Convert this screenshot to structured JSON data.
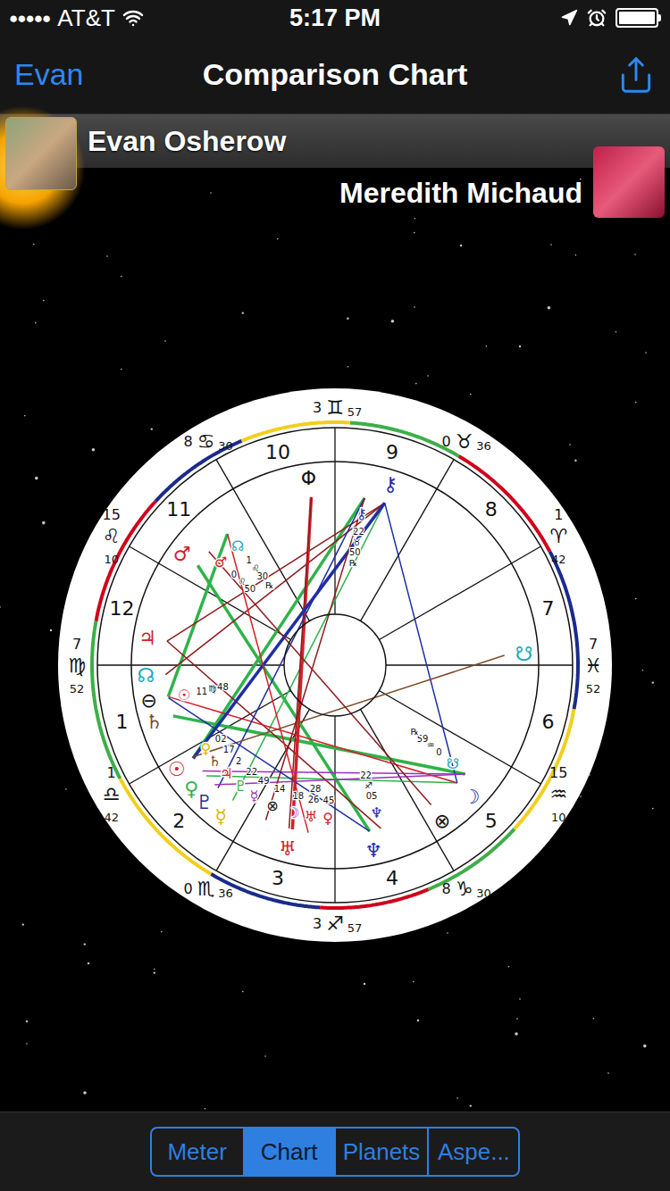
{
  "status_bar": {
    "signal": "●●●●●",
    "carrier": "AT&T",
    "time": "5:17 PM",
    "battery": {
      "level": 1
    }
  },
  "nav_bar": {
    "back": "Evan",
    "title": "Comparison Chart"
  },
  "people": [
    {
      "name": "Evan Osherow",
      "highlighted": true
    },
    {
      "name": "Meredith Michaud",
      "highlighted": false
    }
  ],
  "chart": {
    "cusps": [
      {
        "house": "1",
        "degree": "7",
        "sign": "♍",
        "minutes": "52",
        "longitude": 157.87
      },
      {
        "house": "2",
        "degree": "1",
        "sign": "♎",
        "minutes": "42",
        "longitude": 181.7
      },
      {
        "house": "3",
        "degree": "0",
        "sign": "♏",
        "minutes": "36",
        "longitude": 210.6
      },
      {
        "house": "4",
        "degree": "3",
        "sign": "♐",
        "minutes": "57",
        "longitude": 243.95
      },
      {
        "house": "5",
        "degree": "8",
        "sign": "♑",
        "minutes": "30",
        "longitude": 278.5
      },
      {
        "house": "6",
        "degree": "15",
        "sign": "♒",
        "minutes": "10",
        "longitude": 315.17
      },
      {
        "house": "7",
        "degree": "7",
        "sign": "♓",
        "minutes": "52",
        "longitude": 337.87
      },
      {
        "house": "8",
        "degree": "1",
        "sign": "♈",
        "minutes": "42",
        "longitude": 1.7
      },
      {
        "house": "9",
        "degree": "0",
        "sign": "♉",
        "minutes": "36",
        "longitude": 30.6
      },
      {
        "house": "10",
        "degree": "3",
        "sign": "♊",
        "minutes": "57",
        "longitude": 63.95
      },
      {
        "house": "11",
        "degree": "8",
        "sign": "♋",
        "minutes": "30",
        "longitude": 98.5
      },
      {
        "house": "12",
        "degree": "15",
        "sign": "♌",
        "minutes": "10",
        "longitude": 135.17
      }
    ],
    "signs": [
      {
        "color": "#d0021b"
      },
      {
        "color": "#3fae49"
      },
      {
        "color": "#f2cf1d"
      },
      {
        "color": "#1a2b8c"
      },
      {
        "color": "#d0021b"
      },
      {
        "color": "#3fae49"
      },
      {
        "color": "#f2cf1d"
      },
      {
        "color": "#1a2b8c"
      },
      {
        "color": "#d0021b"
      },
      {
        "color": "#3fae49"
      },
      {
        "color": "#f2cf1d"
      },
      {
        "color": "#1a2b8c"
      }
    ],
    "planets": [
      {
        "glyph": "♂",
        "ring": "outer",
        "longitude": 127.8,
        "color": "#d3202a",
        "labels": []
      },
      {
        "glyph": "♃",
        "ring": "outer",
        "longitude": 151.7,
        "color": "#d3202a",
        "labels": []
      },
      {
        "glyph": "☊",
        "ring": "outer",
        "longitude": 160.4,
        "color": "#19a8b8",
        "labels": []
      },
      {
        "glyph": "⊖",
        "ring": "outer",
        "longitude": 166.4,
        "color": "#111111",
        "labels": []
      },
      {
        "glyph": "♄",
        "ring": "outer",
        "longitude": 171.7,
        "color": "#7a4a2a",
        "labels": []
      },
      {
        "glyph": "☉",
        "ring": "outer",
        "longitude": 184.9,
        "color": "#d3202a",
        "labels": []
      },
      {
        "glyph": "♀",
        "ring": "outer",
        "longitude": 192.0,
        "color": "#2fb34a",
        "labels": []
      },
      {
        "glyph": "♇",
        "ring": "outer",
        "longitude": 197.5,
        "color": "#1f2ea3",
        "labels": []
      },
      {
        "glyph": "☿",
        "ring": "outer",
        "longitude": 203.8,
        "color": "#e0b400",
        "labels": []
      },
      {
        "glyph": "♅",
        "ring": "outer",
        "longitude": 227.8,
        "color": "#d3202a",
        "labels": []
      },
      {
        "glyph": "♆",
        "ring": "outer",
        "longitude": 257.5,
        "color": "#1f2ea3",
        "labels": []
      },
      {
        "glyph": "⊗",
        "ring": "outer",
        "longitude": 284.0,
        "color": "#111111",
        "labels": []
      },
      {
        "glyph": "☽",
        "ring": "outer",
        "longitude": 298.1,
        "color": "#1f2ea3",
        "labels": []
      },
      {
        "glyph": "☋",
        "ring": "outer",
        "longitude": 340.5,
        "color": "#19a8b8",
        "labels": []
      },
      {
        "glyph": "⚷",
        "ring": "outer",
        "longitude": 45.0,
        "color": "#1f2ea3",
        "labels": []
      },
      {
        "glyph": "Φ",
        "ring": "outer",
        "longitude": 73.2,
        "color": "#111111",
        "labels": []
      },
      {
        "glyph": "♂",
        "ring": "inner",
        "longitude": 120.5,
        "color": "#d3202a",
        "labels": [
          "0",
          "♌",
          "50"
        ]
      },
      {
        "glyph": "☊",
        "ring": "inner",
        "longitude": 109.9,
        "color": "#19a8b8",
        "labels": [
          "1",
          "♌",
          "30",
          "℞"
        ]
      },
      {
        "glyph": "⚷",
        "ring": "inner",
        "longitude": 52.8,
        "color": "#1f2ea3",
        "labels": [
          "22",
          "♉",
          "50",
          "℞"
        ]
      },
      {
        "glyph": "☉",
        "ring": "inner",
        "longitude": 166.7,
        "color": "#d3202a",
        "labels": [
          "11",
          "♍",
          "48"
        ]
      },
      {
        "glyph": "☋",
        "ring": "inner",
        "longitude": 303.0,
        "color": "#19a8b8",
        "labels": [
          "0",
          "♒",
          "59",
          "℞"
        ]
      },
      {
        "glyph": "♆",
        "ring": "inner",
        "longitude": 262.0,
        "color": "#1f2ea3",
        "labels": [
          "05",
          "♐",
          "22"
        ]
      },
      {
        "glyph": "☽",
        "ring": "inner",
        "longitude": 226.5,
        "color": "#9b30c0",
        "labels": [
          "18"
        ]
      },
      {
        "glyph": "♅",
        "ring": "inner",
        "longitude": 233.9,
        "color": "#d3202a",
        "labels": [
          "26",
          "28"
        ]
      },
      {
        "glyph": "⊗",
        "ring": "inner",
        "longitude": 217.2,
        "color": "#111111",
        "labels": [
          "14"
        ]
      },
      {
        "glyph": "♀",
        "ring": "inner",
        "longitude": 184.4,
        "color": "#e0b400",
        "labels": [
          "02"
        ]
      },
      {
        "glyph": "♄",
        "ring": "inner",
        "longitude": 190.0,
        "color": "#7a4a2a",
        "labels": [
          "17"
        ]
      },
      {
        "glyph": "♃",
        "ring": "inner",
        "longitude": 196.0,
        "color": "#d3202a",
        "labels": [
          "2"
        ]
      },
      {
        "glyph": "♇",
        "ring": "inner",
        "longitude": 203.0,
        "color": "#2fb34a",
        "labels": [
          "22"
        ]
      },
      {
        "glyph": "☿",
        "ring": "inner",
        "longitude": 209.0,
        "color": "#9b30c0",
        "labels": [
          "49"
        ]
      },
      {
        "glyph": "♀",
        "ring": "inner",
        "longitude": 241.0,
        "color": "#d3202a",
        "labels": [
          "45"
        ]
      }
    ],
    "aspects": [
      {
        "from": 127.8,
        "to": 257.5,
        "color": "#2fb34a",
        "strong": true
      },
      {
        "from": 109.9,
        "to": 166.4,
        "color": "#2fb34a",
        "strong": true
      },
      {
        "from": 171.7,
        "to": 303.0,
        "color": "#2fb34a",
        "strong": true
      },
      {
        "from": 192.0,
        "to": 298.1,
        "color": "#2fb34a",
        "strong": false
      },
      {
        "from": 203.8,
        "to": 45.0,
        "color": "#2fb34a",
        "strong": false
      },
      {
        "from": 184.9,
        "to": 52.8,
        "color": "#2fb34a",
        "strong": true
      },
      {
        "from": 151.7,
        "to": 262.0,
        "color": "#8c1c1c",
        "strong": false
      },
      {
        "from": 151.7,
        "to": 45.0,
        "color": "#8c1c1c",
        "strong": false
      },
      {
        "from": 160.4,
        "to": 45.0,
        "color": "#8c1c1c",
        "strong": false
      },
      {
        "from": 166.4,
        "to": 298.1,
        "color": "#d3202a",
        "strong": false
      },
      {
        "from": 73.2,
        "to": 227.8,
        "color": "#d3202a",
        "strong": true
      },
      {
        "from": 73.2,
        "to": 226.5,
        "color": "#8c1c1c",
        "strong": false
      },
      {
        "from": 45.0,
        "to": 184.9,
        "color": "#1f2ea3",
        "strong": true
      },
      {
        "from": 52.8,
        "to": 197.5,
        "color": "#1f2ea3",
        "strong": false
      },
      {
        "from": 45.0,
        "to": 298.1,
        "color": "#1f2ea3",
        "strong": false
      },
      {
        "from": 303.0,
        "to": 190.0,
        "color": "#9b30c0",
        "strong": false
      },
      {
        "from": 303.0,
        "to": 196.0,
        "color": "#9b30c0",
        "strong": false
      },
      {
        "from": 340.5,
        "to": 184.4,
        "color": "#7a4a2a",
        "strong": false
      },
      {
        "from": 284.0,
        "to": 120.5,
        "color": "#8c1c1c",
        "strong": false
      },
      {
        "from": 217.2,
        "to": 52.8,
        "color": "#8c1c1c",
        "strong": false
      },
      {
        "from": 257.5,
        "to": 166.7,
        "color": "#1f2ea3",
        "strong": false
      },
      {
        "from": 233.9,
        "to": 109.9,
        "color": "#d3202a",
        "strong": false
      }
    ]
  },
  "tabs": [
    {
      "label": "Meter",
      "selected": false
    },
    {
      "label": "Chart",
      "selected": true
    },
    {
      "label": "Planets",
      "selected": false
    },
    {
      "label": "Aspe...",
      "selected": false
    }
  ]
}
